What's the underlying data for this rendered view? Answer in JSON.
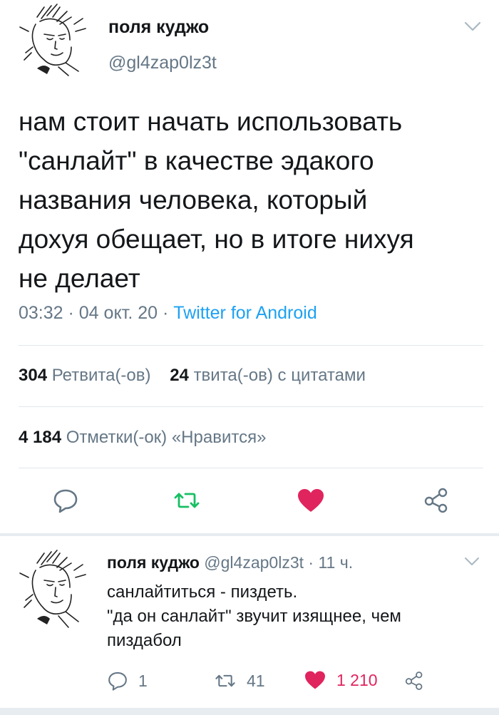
{
  "tweet": {
    "display_name": "поля куджо",
    "handle": "@gl4zap0lz3t",
    "text_lines": [
      "нам стоит начать использовать",
      "\"санлайт\" в качестве эдакого",
      "названия человека, который",
      "дохуя обещает, но в итоге нихуя",
      "не делает"
    ],
    "time": "03:32",
    "date": "04 окт. 20",
    "source": "Twitter for Android",
    "separator": " · ",
    "retweets_count": "304",
    "retweets_label": "Ретвита(-ов)",
    "quotes_count": "24",
    "quotes_label": "твита(-ов) с цитатами",
    "likes_count": "4 184",
    "likes_label": "Отметки(-ок) «Нравится»"
  },
  "reply": {
    "display_name": "поля куджо",
    "handle": "@gl4zap0lz3t",
    "age": "11 ч.",
    "separator": " · ",
    "text_lines": [
      "санлайтиться - пиздеть.",
      "\"да он санлайт\" звучит изящнее, чем",
      "пиздабол"
    ],
    "reply_count": "1",
    "retweet_count": "41",
    "like_count": "1 210"
  },
  "icons": {
    "reply": "reply-bubble-icon",
    "retweet": "retweet-icon",
    "like": "heart-icon",
    "share": "share-icon",
    "menu": "chevron-down-icon"
  },
  "colors": {
    "accent": "#1da1f2",
    "retweet_green": "#17bf63",
    "like_red": "#e0245e",
    "muted": "#657786",
    "divider": "#e1e8ed"
  }
}
